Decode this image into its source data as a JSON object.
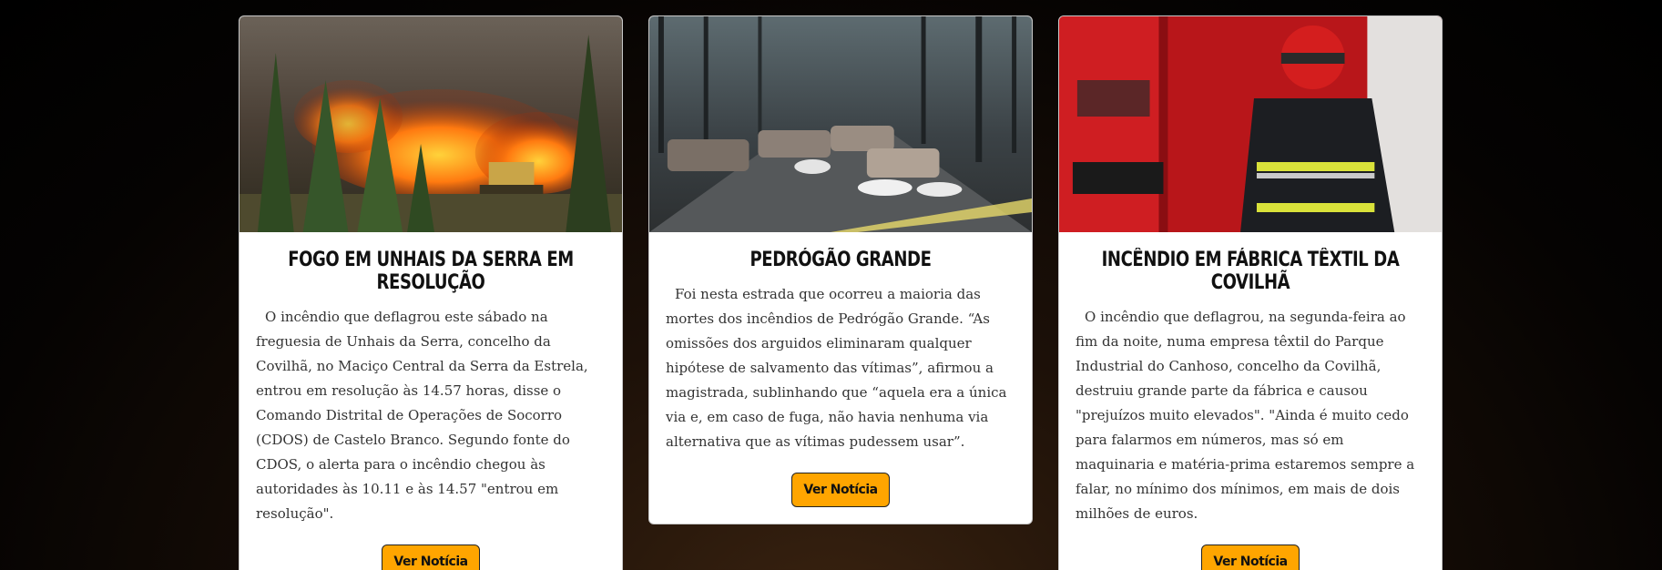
{
  "colors": {
    "button_bg": "#ffa500",
    "page_bg": "#0a0604"
  },
  "cards": [
    {
      "image_icon": "forest-fire-photo",
      "title": "Fogo em Unhais da Serra em resolução",
      "text": "O incêndio que deflagrou este sábado na freguesia de Unhais da Serra, concelho da Covilhã, no Maciço Central da Serra da Estrela, entrou em resolução às 14.57 horas, disse o Comando Distrital de Operações de Socorro (CDOS) de Castelo Branco. Segundo fonte do CDOS, o alerta para o incêndio chegou às autoridades às 10.11 e às 14.57 \"entrou em resolução\".",
      "button_label": "Ver Notícia"
    },
    {
      "image_icon": "burned-cars-road-photo",
      "title": "Pedrógão Grande",
      "text": "Foi nesta estrada que ocorreu a maioria das mortes dos incêndios de Pedrógão Grande. “As omissões dos arguidos eliminaram qualquer hipótese de salvamento das vítimas”, afirmou a magistrada, sublinhando que “aquela era a única via e, em caso de fuga, não havia nenhuma via alternativa que as vítimas pudessem usar”.",
      "button_label": "Ver Notícia"
    },
    {
      "image_icon": "firefighter-truck-photo",
      "title": "Incêndio em fábrica têxtil da Covilhã",
      "text": "O incêndio que deflagrou, na segunda-feira ao fim da noite, numa empresa têxtil do Parque Industrial do Canhoso, concelho da Covilhã, destruiu grande parte da fábrica e causou \"prejuízos muito elevados\". \"Ainda é muito cedo para falarmos em números, mas só em maquinaria e matéria-prima estaremos sempre a falar, no mínimo dos mínimos, em mais de dois milhões de euros.",
      "button_label": "Ver Notícia"
    }
  ]
}
